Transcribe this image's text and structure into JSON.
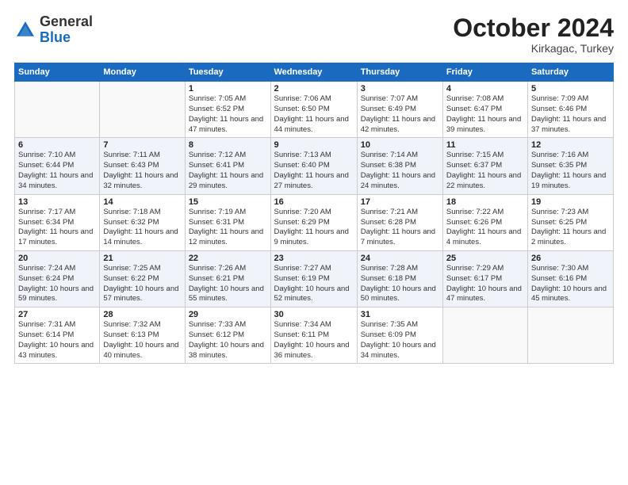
{
  "header": {
    "logo_general": "General",
    "logo_blue": "Blue",
    "month_title": "October 2024",
    "subtitle": "Kirkagac, Turkey"
  },
  "days_of_week": [
    "Sunday",
    "Monday",
    "Tuesday",
    "Wednesday",
    "Thursday",
    "Friday",
    "Saturday"
  ],
  "weeks": [
    [
      {
        "num": "",
        "info": ""
      },
      {
        "num": "",
        "info": ""
      },
      {
        "num": "1",
        "info": "Sunrise: 7:05 AM\nSunset: 6:52 PM\nDaylight: 11 hours and 47 minutes."
      },
      {
        "num": "2",
        "info": "Sunrise: 7:06 AM\nSunset: 6:50 PM\nDaylight: 11 hours and 44 minutes."
      },
      {
        "num": "3",
        "info": "Sunrise: 7:07 AM\nSunset: 6:49 PM\nDaylight: 11 hours and 42 minutes."
      },
      {
        "num": "4",
        "info": "Sunrise: 7:08 AM\nSunset: 6:47 PM\nDaylight: 11 hours and 39 minutes."
      },
      {
        "num": "5",
        "info": "Sunrise: 7:09 AM\nSunset: 6:46 PM\nDaylight: 11 hours and 37 minutes."
      }
    ],
    [
      {
        "num": "6",
        "info": "Sunrise: 7:10 AM\nSunset: 6:44 PM\nDaylight: 11 hours and 34 minutes."
      },
      {
        "num": "7",
        "info": "Sunrise: 7:11 AM\nSunset: 6:43 PM\nDaylight: 11 hours and 32 minutes."
      },
      {
        "num": "8",
        "info": "Sunrise: 7:12 AM\nSunset: 6:41 PM\nDaylight: 11 hours and 29 minutes."
      },
      {
        "num": "9",
        "info": "Sunrise: 7:13 AM\nSunset: 6:40 PM\nDaylight: 11 hours and 27 minutes."
      },
      {
        "num": "10",
        "info": "Sunrise: 7:14 AM\nSunset: 6:38 PM\nDaylight: 11 hours and 24 minutes."
      },
      {
        "num": "11",
        "info": "Sunrise: 7:15 AM\nSunset: 6:37 PM\nDaylight: 11 hours and 22 minutes."
      },
      {
        "num": "12",
        "info": "Sunrise: 7:16 AM\nSunset: 6:35 PM\nDaylight: 11 hours and 19 minutes."
      }
    ],
    [
      {
        "num": "13",
        "info": "Sunrise: 7:17 AM\nSunset: 6:34 PM\nDaylight: 11 hours and 17 minutes."
      },
      {
        "num": "14",
        "info": "Sunrise: 7:18 AM\nSunset: 6:32 PM\nDaylight: 11 hours and 14 minutes."
      },
      {
        "num": "15",
        "info": "Sunrise: 7:19 AM\nSunset: 6:31 PM\nDaylight: 11 hours and 12 minutes."
      },
      {
        "num": "16",
        "info": "Sunrise: 7:20 AM\nSunset: 6:29 PM\nDaylight: 11 hours and 9 minutes."
      },
      {
        "num": "17",
        "info": "Sunrise: 7:21 AM\nSunset: 6:28 PM\nDaylight: 11 hours and 7 minutes."
      },
      {
        "num": "18",
        "info": "Sunrise: 7:22 AM\nSunset: 6:26 PM\nDaylight: 11 hours and 4 minutes."
      },
      {
        "num": "19",
        "info": "Sunrise: 7:23 AM\nSunset: 6:25 PM\nDaylight: 11 hours and 2 minutes."
      }
    ],
    [
      {
        "num": "20",
        "info": "Sunrise: 7:24 AM\nSunset: 6:24 PM\nDaylight: 10 hours and 59 minutes."
      },
      {
        "num": "21",
        "info": "Sunrise: 7:25 AM\nSunset: 6:22 PM\nDaylight: 10 hours and 57 minutes."
      },
      {
        "num": "22",
        "info": "Sunrise: 7:26 AM\nSunset: 6:21 PM\nDaylight: 10 hours and 55 minutes."
      },
      {
        "num": "23",
        "info": "Sunrise: 7:27 AM\nSunset: 6:19 PM\nDaylight: 10 hours and 52 minutes."
      },
      {
        "num": "24",
        "info": "Sunrise: 7:28 AM\nSunset: 6:18 PM\nDaylight: 10 hours and 50 minutes."
      },
      {
        "num": "25",
        "info": "Sunrise: 7:29 AM\nSunset: 6:17 PM\nDaylight: 10 hours and 47 minutes."
      },
      {
        "num": "26",
        "info": "Sunrise: 7:30 AM\nSunset: 6:16 PM\nDaylight: 10 hours and 45 minutes."
      }
    ],
    [
      {
        "num": "27",
        "info": "Sunrise: 7:31 AM\nSunset: 6:14 PM\nDaylight: 10 hours and 43 minutes."
      },
      {
        "num": "28",
        "info": "Sunrise: 7:32 AM\nSunset: 6:13 PM\nDaylight: 10 hours and 40 minutes."
      },
      {
        "num": "29",
        "info": "Sunrise: 7:33 AM\nSunset: 6:12 PM\nDaylight: 10 hours and 38 minutes."
      },
      {
        "num": "30",
        "info": "Sunrise: 7:34 AM\nSunset: 6:11 PM\nDaylight: 10 hours and 36 minutes."
      },
      {
        "num": "31",
        "info": "Sunrise: 7:35 AM\nSunset: 6:09 PM\nDaylight: 10 hours and 34 minutes."
      },
      {
        "num": "",
        "info": ""
      },
      {
        "num": "",
        "info": ""
      }
    ]
  ]
}
